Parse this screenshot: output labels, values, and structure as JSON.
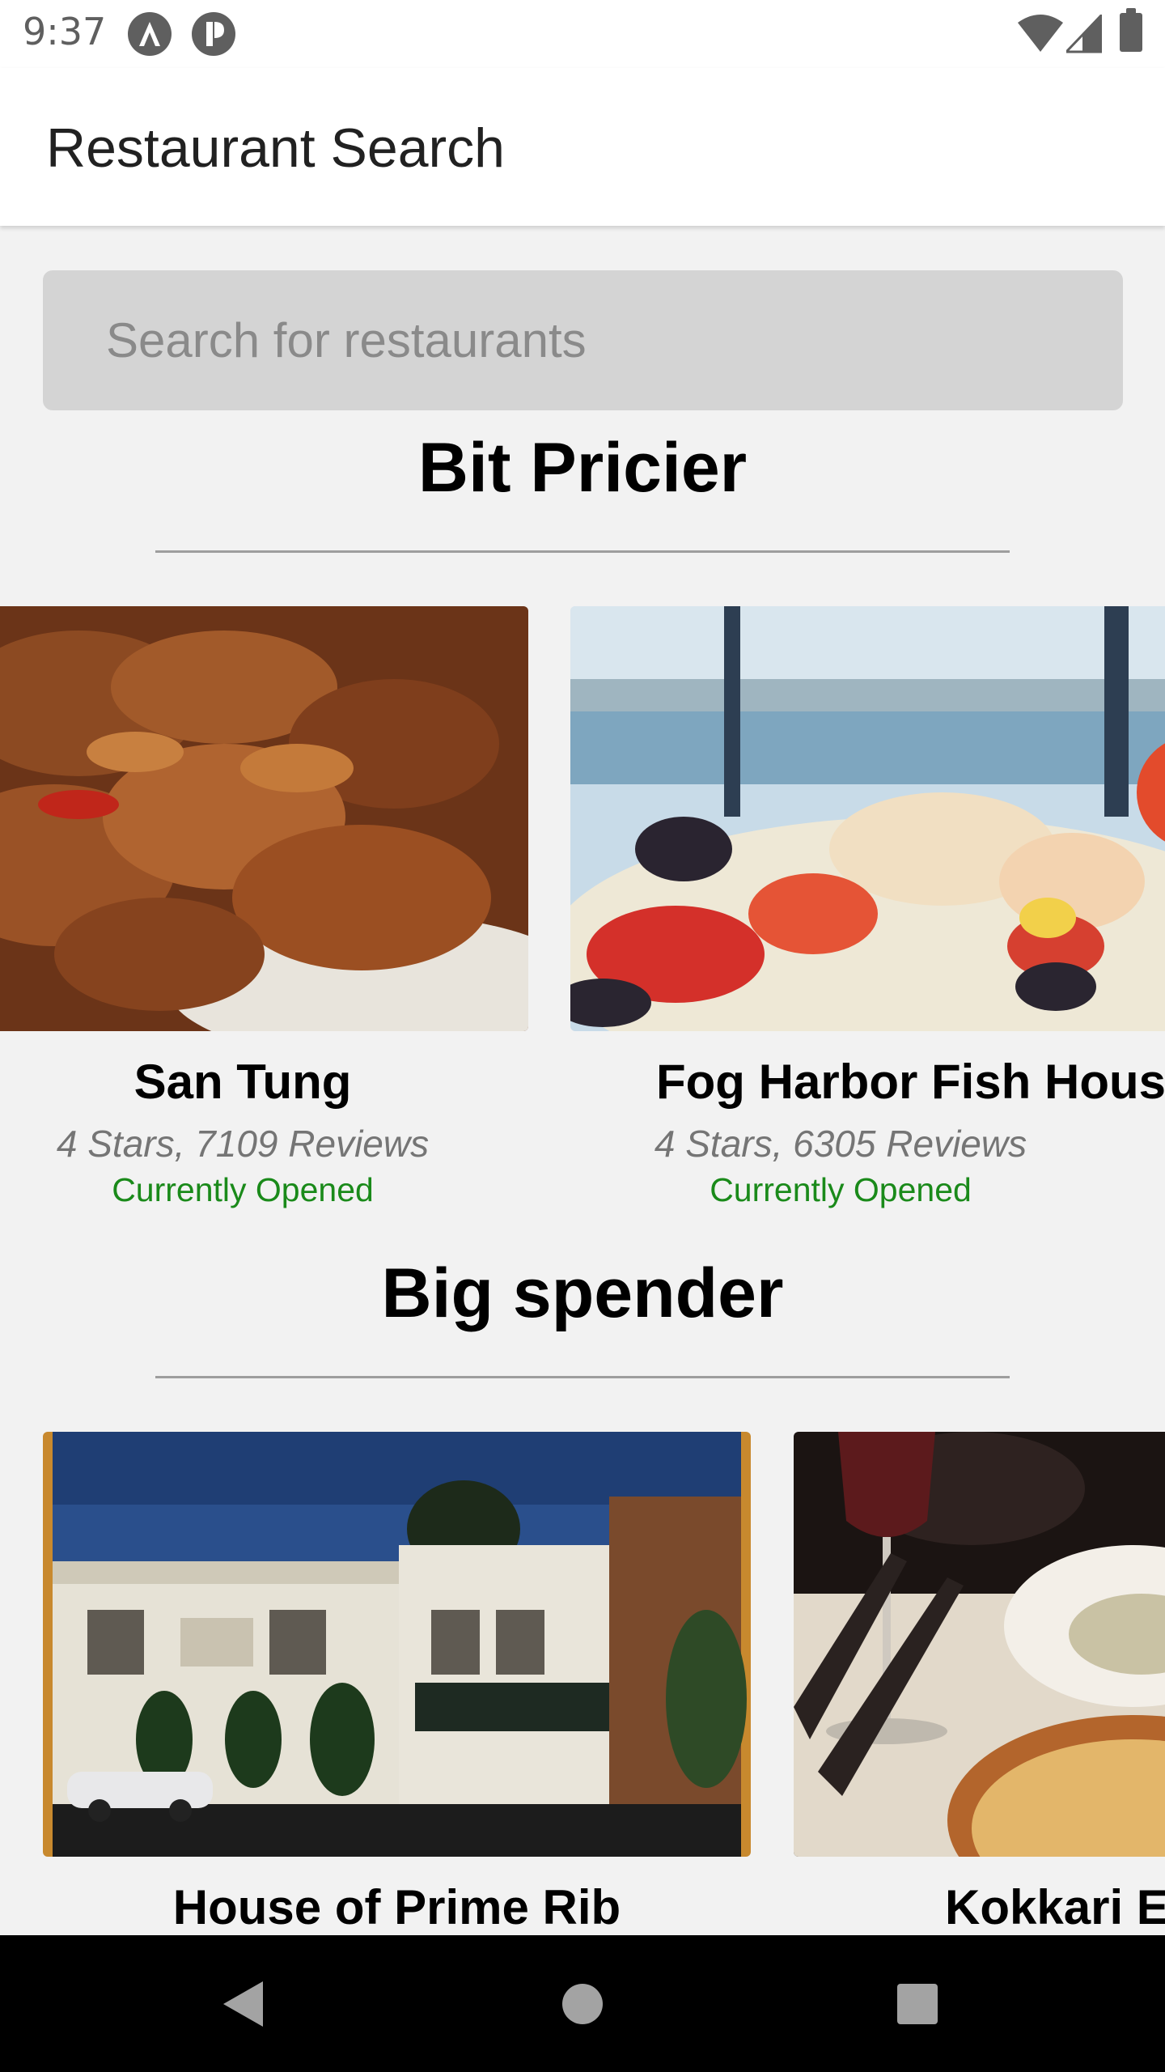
{
  "status_bar": {
    "time": "9:37",
    "icons": [
      "a-badge-icon",
      "p-badge-icon",
      "wifi-icon",
      "cell-signal-icon",
      "battery-icon"
    ]
  },
  "app_bar": {
    "title": "Restaurant Search"
  },
  "search": {
    "placeholder": "Search for restaurants",
    "value": ""
  },
  "sections": [
    {
      "title": "Bit Pricier",
      "cards": [
        {
          "name": "San Tung",
          "meta": "4 Stars, 7109 Reviews",
          "status": "Currently Opened",
          "image": "fried-chicken-wings-photo"
        },
        {
          "name": "Fog Harbor Fish House",
          "meta": "4 Stars, 6305 Reviews",
          "status": "Currently Opened",
          "image": "seafood-platter-photo"
        }
      ]
    },
    {
      "title": "Big spender",
      "cards": [
        {
          "name": "House of Prime Rib",
          "meta": "",
          "status": "",
          "image": "restaurant-building-photo"
        },
        {
          "name": "Kokkari Estiatorio",
          "meta": "",
          "status": "",
          "image": "wine-glass-dinner-photo"
        }
      ]
    }
  ],
  "nav_bar": {
    "buttons": [
      "back",
      "home",
      "recents"
    ]
  },
  "colors": {
    "open_status": "#1a8a1a",
    "meta_text": "#757575",
    "divider": "#9e9e9e",
    "background": "#f2f2f2"
  }
}
